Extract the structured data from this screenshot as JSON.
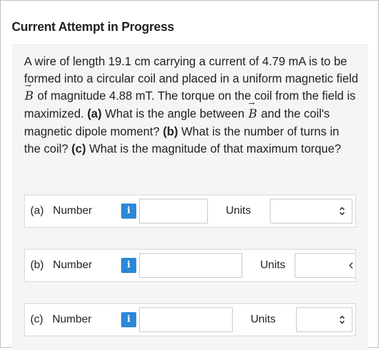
{
  "header": {
    "title": "Current Attempt in Progress"
  },
  "question": {
    "text_1": "A wire of length 19.1 cm carrying a current of 4.79 mA is to be formed into a circular coil and placed in a uniform magnetic field ",
    "symbol_B": "B",
    "vector_arrow": "→",
    "text_2": " of magnitude 4.88 mT. The torque on the coil from the field is maximized. ",
    "part_a_tag": "(a)",
    "text_3": " What is the angle between ",
    "symbol_B2": "B",
    "text_4": " and the coil's magnetic dipole moment? ",
    "part_b_tag": "(b)",
    "text_5": " What is the number of turns in the coil? ",
    "part_c_tag": "(c)",
    "text_6": " What is the magnitude of that maximum torque?"
  },
  "answers": [
    {
      "part": "(a)",
      "number_label": "Number",
      "info_icon": "i",
      "units_label": "Units",
      "value": ""
    },
    {
      "part": "(b)",
      "number_label": "Number",
      "info_icon": "i",
      "units_label": "Units",
      "value": ""
    },
    {
      "part": "(c)",
      "number_label": "Number",
      "info_icon": "i",
      "units_label": "Units",
      "value": ""
    }
  ],
  "colors": {
    "info_button": "#2b88d8",
    "panel_background": "#f5f5f5"
  },
  "icons": {
    "info": "info-icon",
    "select_chevron": "chevron-updown-icon"
  }
}
